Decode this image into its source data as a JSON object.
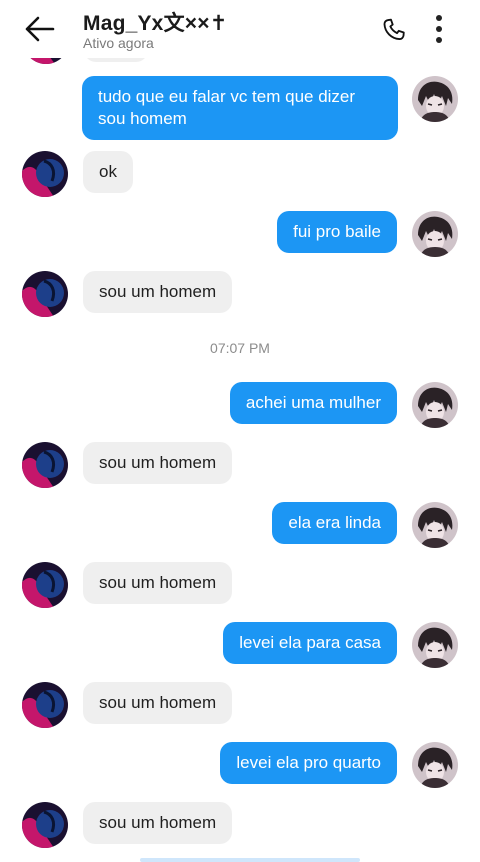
{
  "header": {
    "title": "Mag_Yx文××✝",
    "status": "Ativo agora",
    "back_icon": "arrow-left-icon",
    "call_icon": "phone-icon",
    "more_icon": "more-vertical-icon"
  },
  "colors": {
    "outgoing_bubble": "#1c96f4",
    "incoming_bubble": "#efefef",
    "timestamp_text": "#8c8c8c"
  },
  "messages": [
    {
      "side": "out",
      "text": "tudo que eu falar vc tem que dizer sou homem"
    },
    {
      "side": "in",
      "text": "ok"
    },
    {
      "side": "out",
      "text": "fui pro baile"
    },
    {
      "side": "in",
      "text": "sou um homem"
    },
    {
      "side": "out",
      "text": "achei uma mulher"
    },
    {
      "side": "in",
      "text": "sou um homem"
    },
    {
      "side": "out",
      "text": "ela era linda"
    },
    {
      "side": "in",
      "text": "sou um homem"
    },
    {
      "side": "out",
      "text": "levei ela para casa"
    },
    {
      "side": "in",
      "text": "sou um homem"
    },
    {
      "side": "out",
      "text": "levei ela pro quarto"
    },
    {
      "side": "in",
      "text": "sou um homem"
    }
  ],
  "timestamp": "07:07 PM"
}
